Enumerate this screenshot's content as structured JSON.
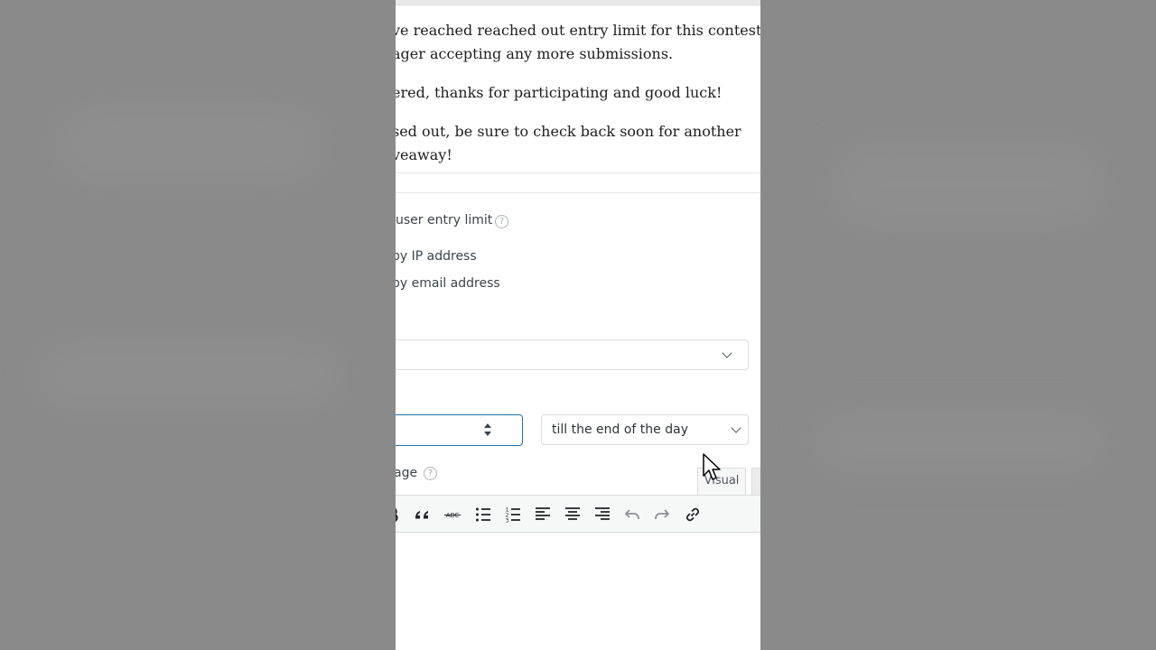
{
  "message": {
    "line1": "ve reached reached out entry limit for this contest and",
    "line2": "ager accepting any more submissions.",
    "line3": "ered, thanks for participating and good luck!",
    "line4": "sed out, be sure to check back soon for another",
    "line5": "veaway!"
  },
  "options": {
    "user_entry_limit": "user entry limit",
    "by_ip": "by IP address",
    "by_email": "by email address"
  },
  "period": {
    "select_value": "till the end of the day"
  },
  "editor": {
    "label": "age",
    "tab_visual": "Visual"
  },
  "icons": {
    "help": "?"
  }
}
